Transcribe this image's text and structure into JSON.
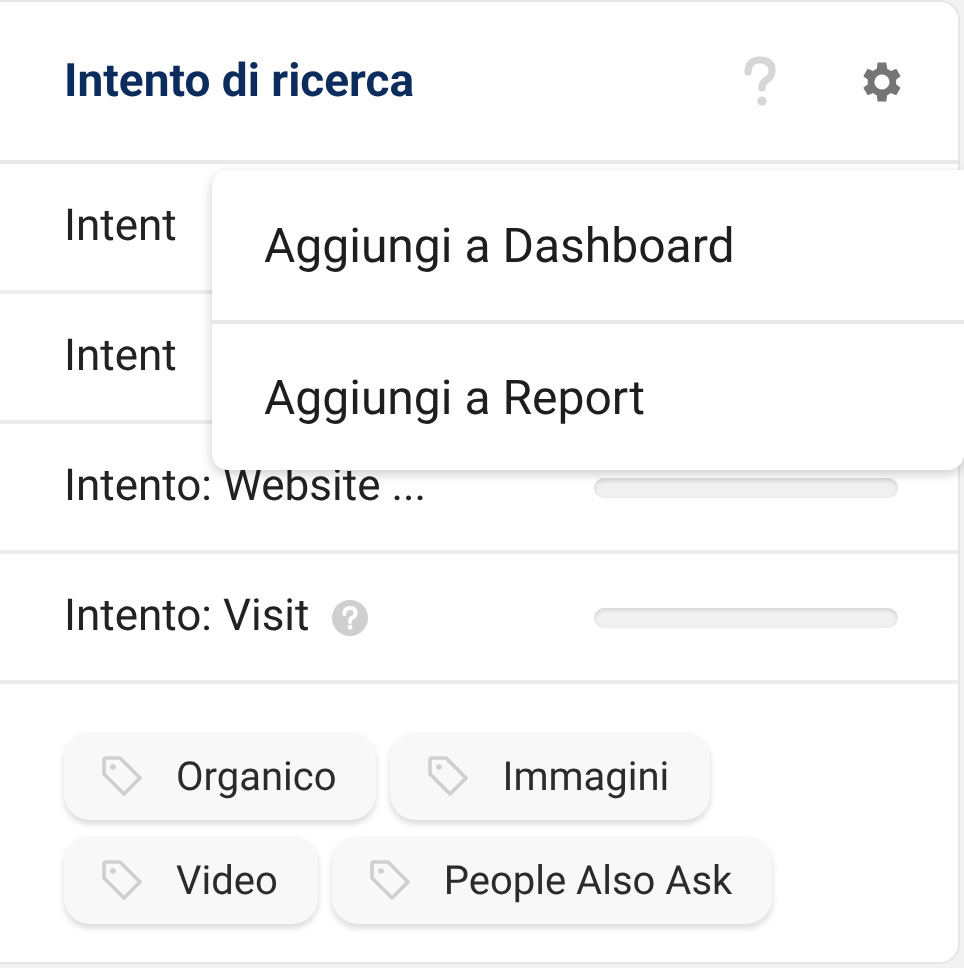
{
  "card": {
    "title": "Intento di ricerca"
  },
  "rows": [
    {
      "label": "Intent"
    },
    {
      "label": "Intent"
    },
    {
      "label": "Intento: Website ...",
      "level": 0
    },
    {
      "label": "Intento: Visit",
      "help": true,
      "level": 0
    }
  ],
  "menu": {
    "items": [
      "Aggiungi a Dashboard",
      "Aggiungi a Report"
    ]
  },
  "tags": [
    "Organico",
    "Immagini",
    "Video",
    "People Also Ask"
  ]
}
